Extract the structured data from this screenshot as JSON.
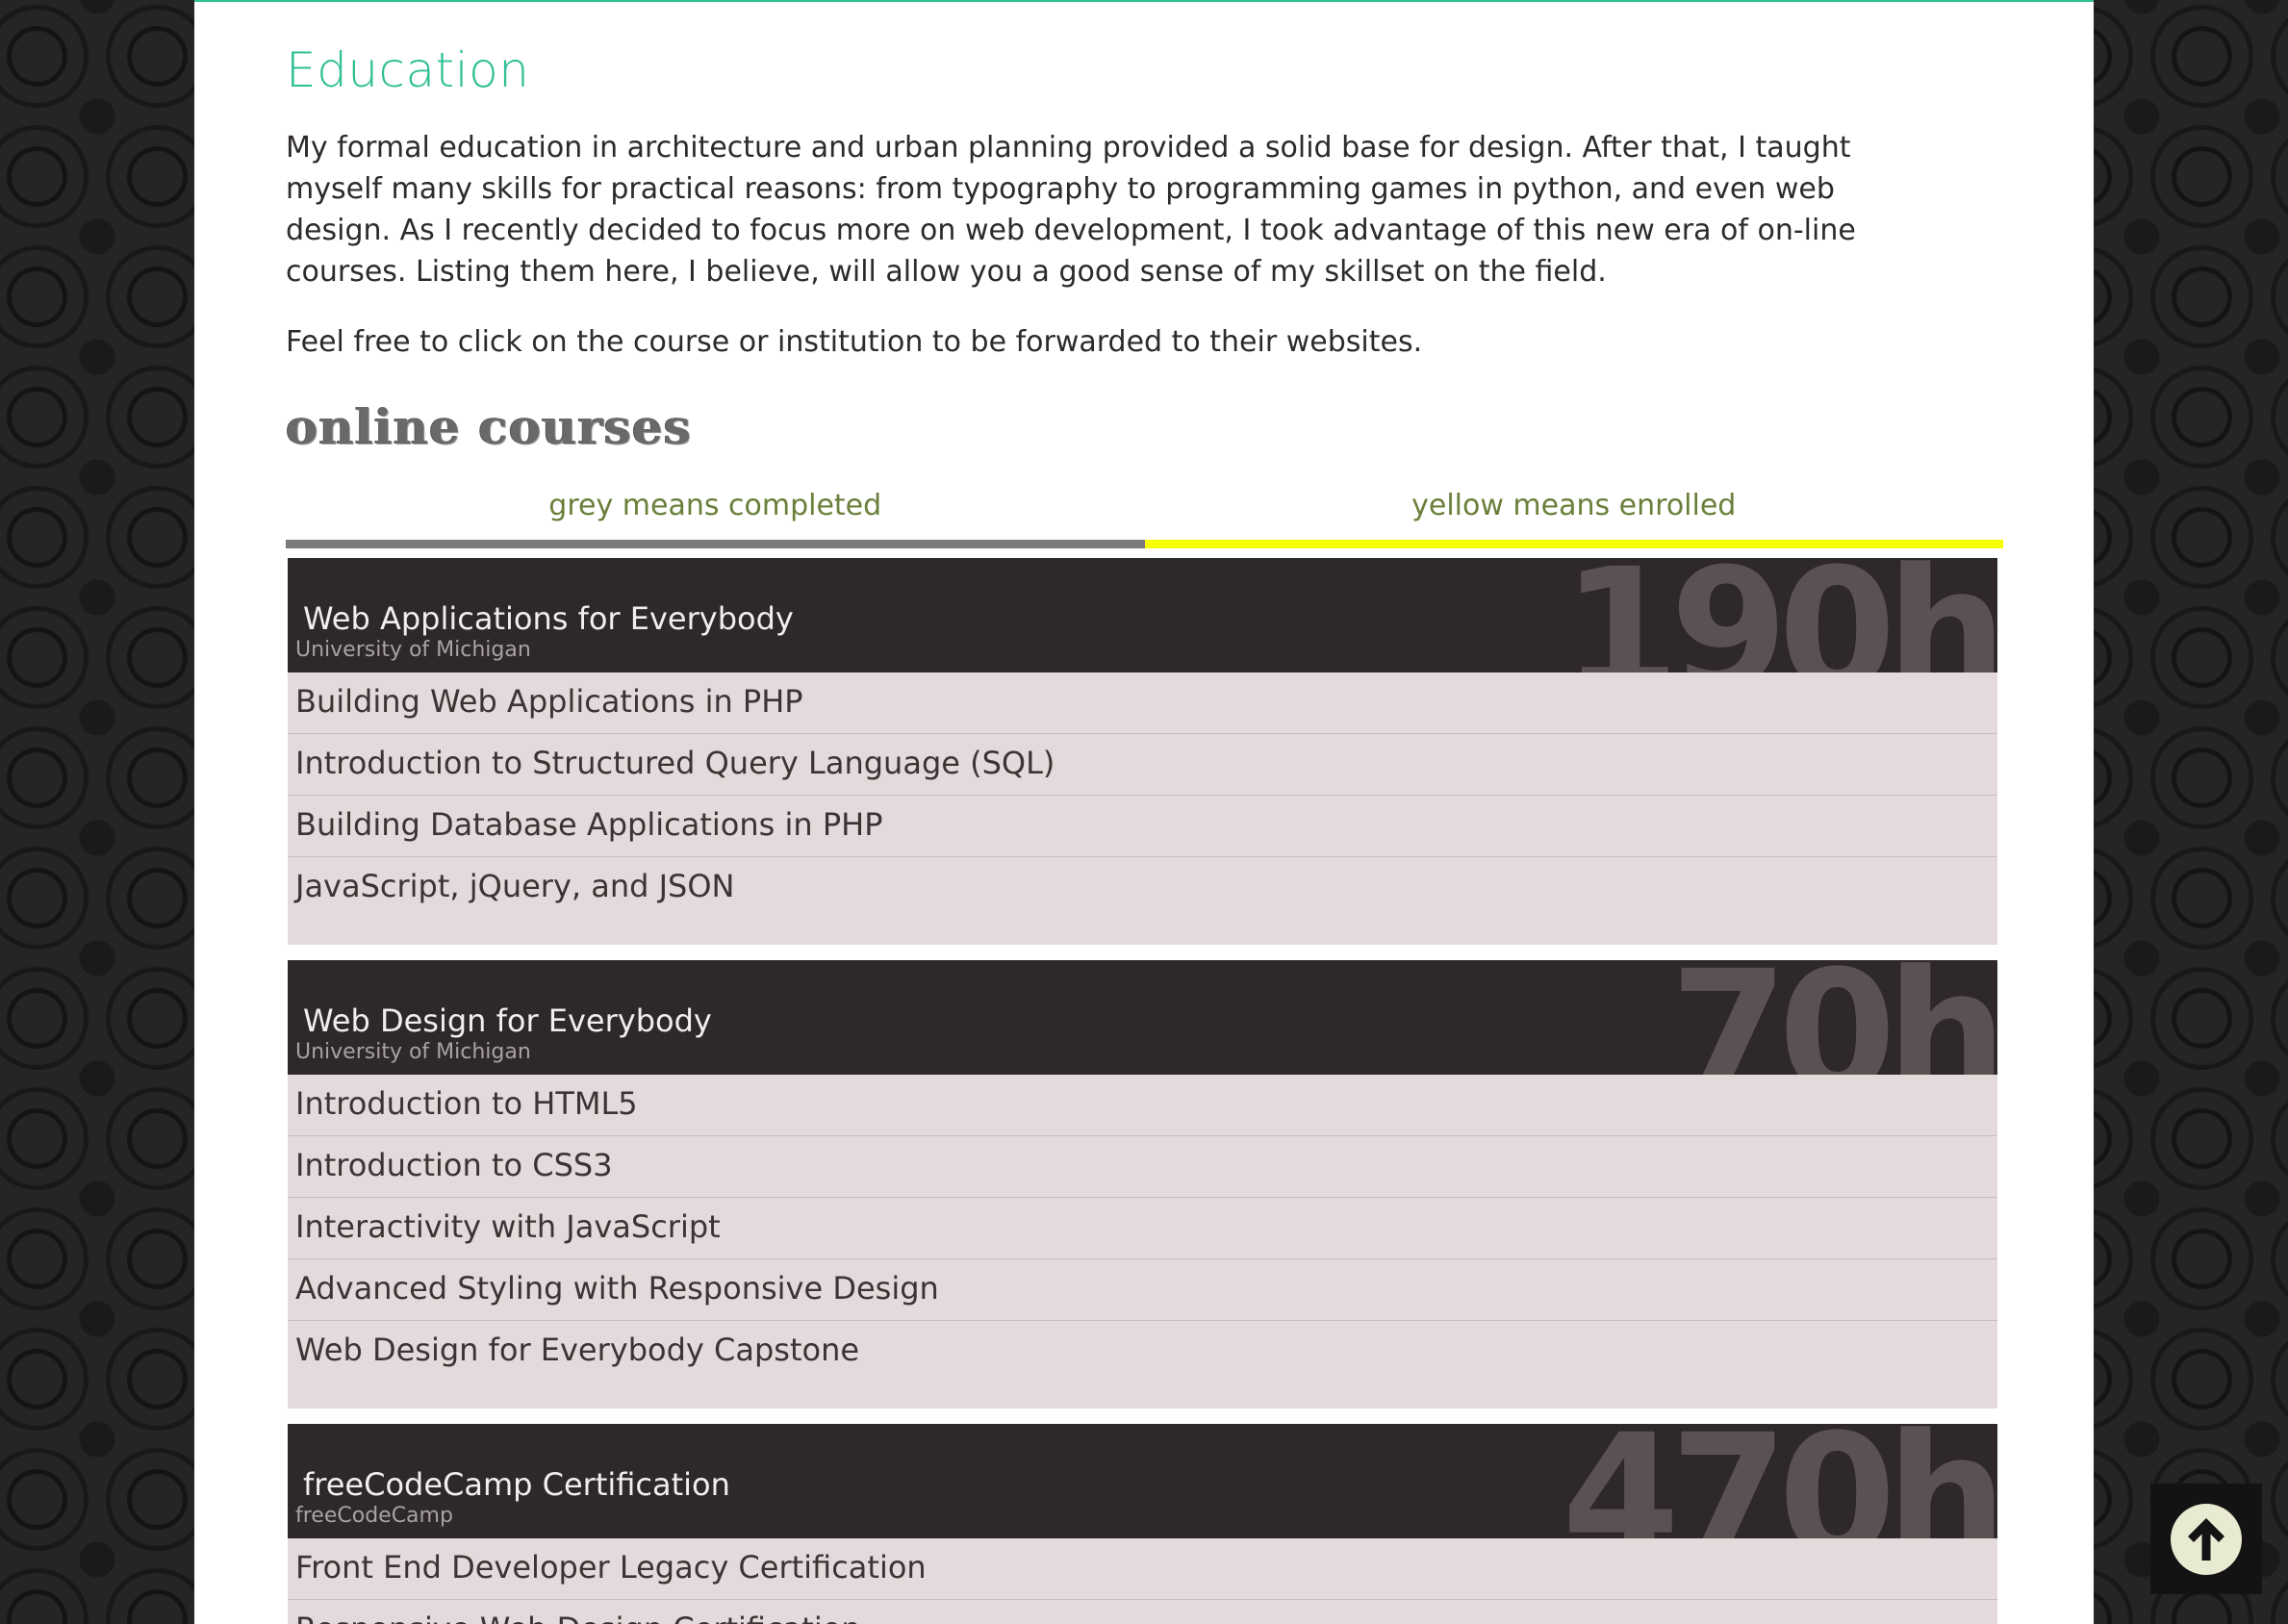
{
  "education": {
    "title": "Education",
    "intro": "My formal education in architecture and urban planning provided a solid base for design. After that, I taught myself many skills for practical reasons: from typography to programming games in python, and even web design. As I recently decided to focus more on web development, I took advantage of this new era of on-line courses. Listing them here, I believe, will allow you a good sense of my skillset on the field.",
    "note": "Feel free to click on the course or institution to be forwarded to their websites."
  },
  "online_courses": {
    "heading": "online courses",
    "legend": {
      "completed": "grey means completed",
      "enrolled": "yellow means enrolled"
    },
    "courses": [
      {
        "title": "Web Applications for Everybody",
        "institution": "University of Michigan",
        "hours": "190h",
        "modules": [
          "Building Web Applications in PHP",
          "Introduction to Structured Query Language (SQL)",
          "Building Database Applications in PHP",
          "JavaScript, jQuery, and JSON"
        ]
      },
      {
        "title": "Web Design for Everybody",
        "institution": "University of Michigan",
        "hours": "70h",
        "modules": [
          "Introduction to HTML5",
          "Introduction to CSS3",
          "Interactivity with JavaScript",
          "Advanced Styling with Responsive Design",
          "Web Design for Everybody Capstone"
        ]
      },
      {
        "title": "freeCodeCamp Certification",
        "institution": "freeCodeCamp",
        "hours": "470h",
        "modules": [
          "Front End Developer Legacy Certification",
          "Responsive Web Design Certification"
        ]
      }
    ]
  },
  "colors": {
    "accent": "#2ebf94",
    "completed_bar": "#7c7979",
    "enrolled_bar": "#f5ff00",
    "course_header_bg": "#2f2828",
    "module_bg": "#e4dadb"
  },
  "scroll_top": {
    "icon": "arrow-up-circle-icon"
  }
}
